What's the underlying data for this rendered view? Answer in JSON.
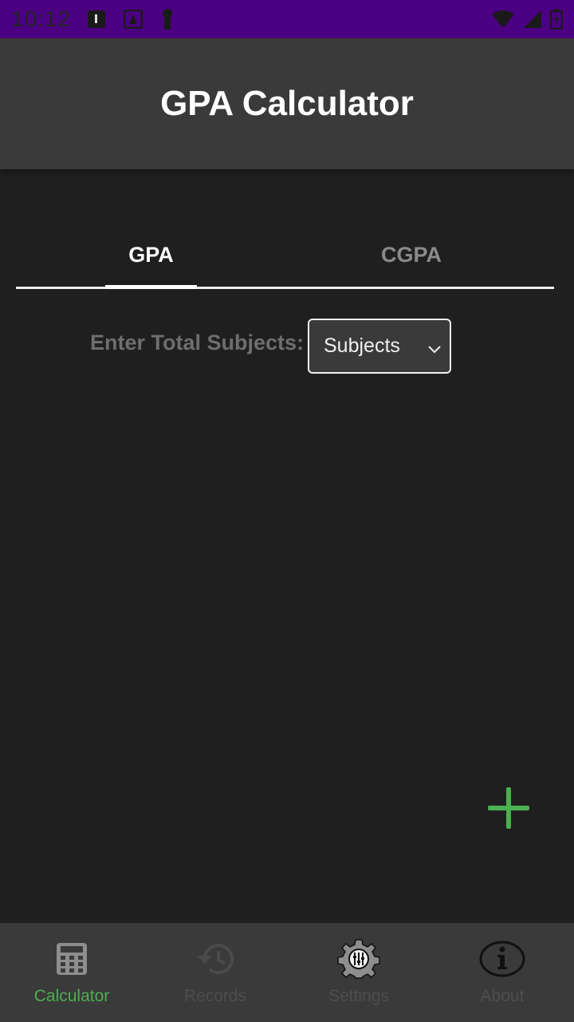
{
  "status_bar": {
    "time": "10:12"
  },
  "app_bar": {
    "title": "GPA Calculator"
  },
  "tabs": [
    {
      "label": "GPA",
      "active": true
    },
    {
      "label": "CGPA",
      "active": false
    }
  ],
  "form": {
    "subjects_label": "Enter Total Subjects:",
    "subjects_select_value": "Subjects"
  },
  "bottom_nav": [
    {
      "label": "Calculator",
      "icon": "calculator-icon",
      "active": true
    },
    {
      "label": "Records",
      "icon": "history-icon",
      "active": false
    },
    {
      "label": "Settings",
      "icon": "settings-gear-icon",
      "active": false
    },
    {
      "label": "About",
      "icon": "info-icon",
      "active": false
    }
  ],
  "colors": {
    "status_bar": "#4b0082",
    "app_bar": "#3a3a3a",
    "background": "#1f1f1f",
    "accent_green": "#4caf50"
  }
}
